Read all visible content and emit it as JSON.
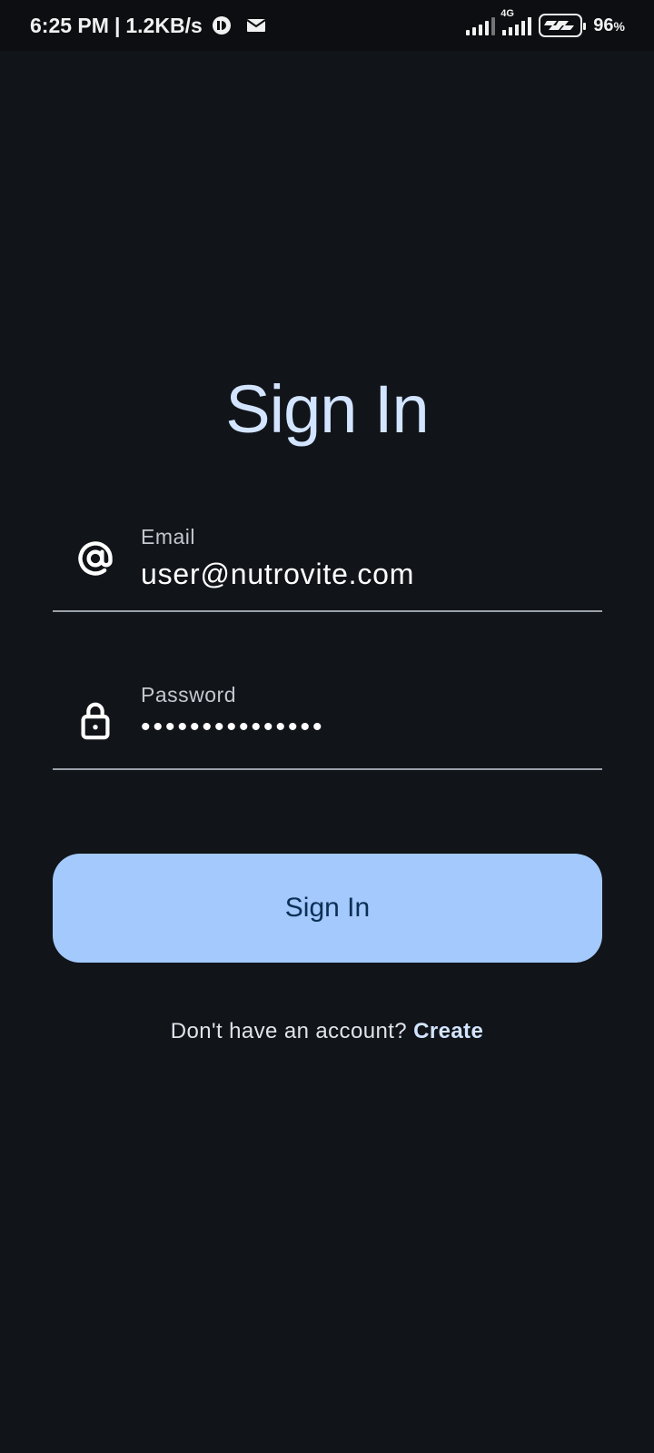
{
  "status_bar": {
    "time": "6:25 PM",
    "separator": "|",
    "net_speed": "1.2KB/s",
    "network_type": "4G",
    "battery_percent": "96",
    "battery_unit": "%",
    "icons": [
      "data-saver-icon",
      "mail-icon",
      "signal-icon",
      "signal-4g-icon",
      "battery-charging-icon"
    ]
  },
  "page": {
    "title": "Sign In"
  },
  "email_field": {
    "label": "Email",
    "value": "user@nutrovite.com",
    "icon": "at-sign-icon"
  },
  "password_field": {
    "label": "Password",
    "value": "•••••••••••••••",
    "icon": "lock-icon"
  },
  "signin_button": {
    "label": "Sign In"
  },
  "footer": {
    "prompt": "Don't have an account?",
    "link": "Create"
  },
  "colors": {
    "background": "#111419",
    "accent": "#a3c9fd",
    "title": "#d2e4ff",
    "button_text": "#0b2f55"
  }
}
